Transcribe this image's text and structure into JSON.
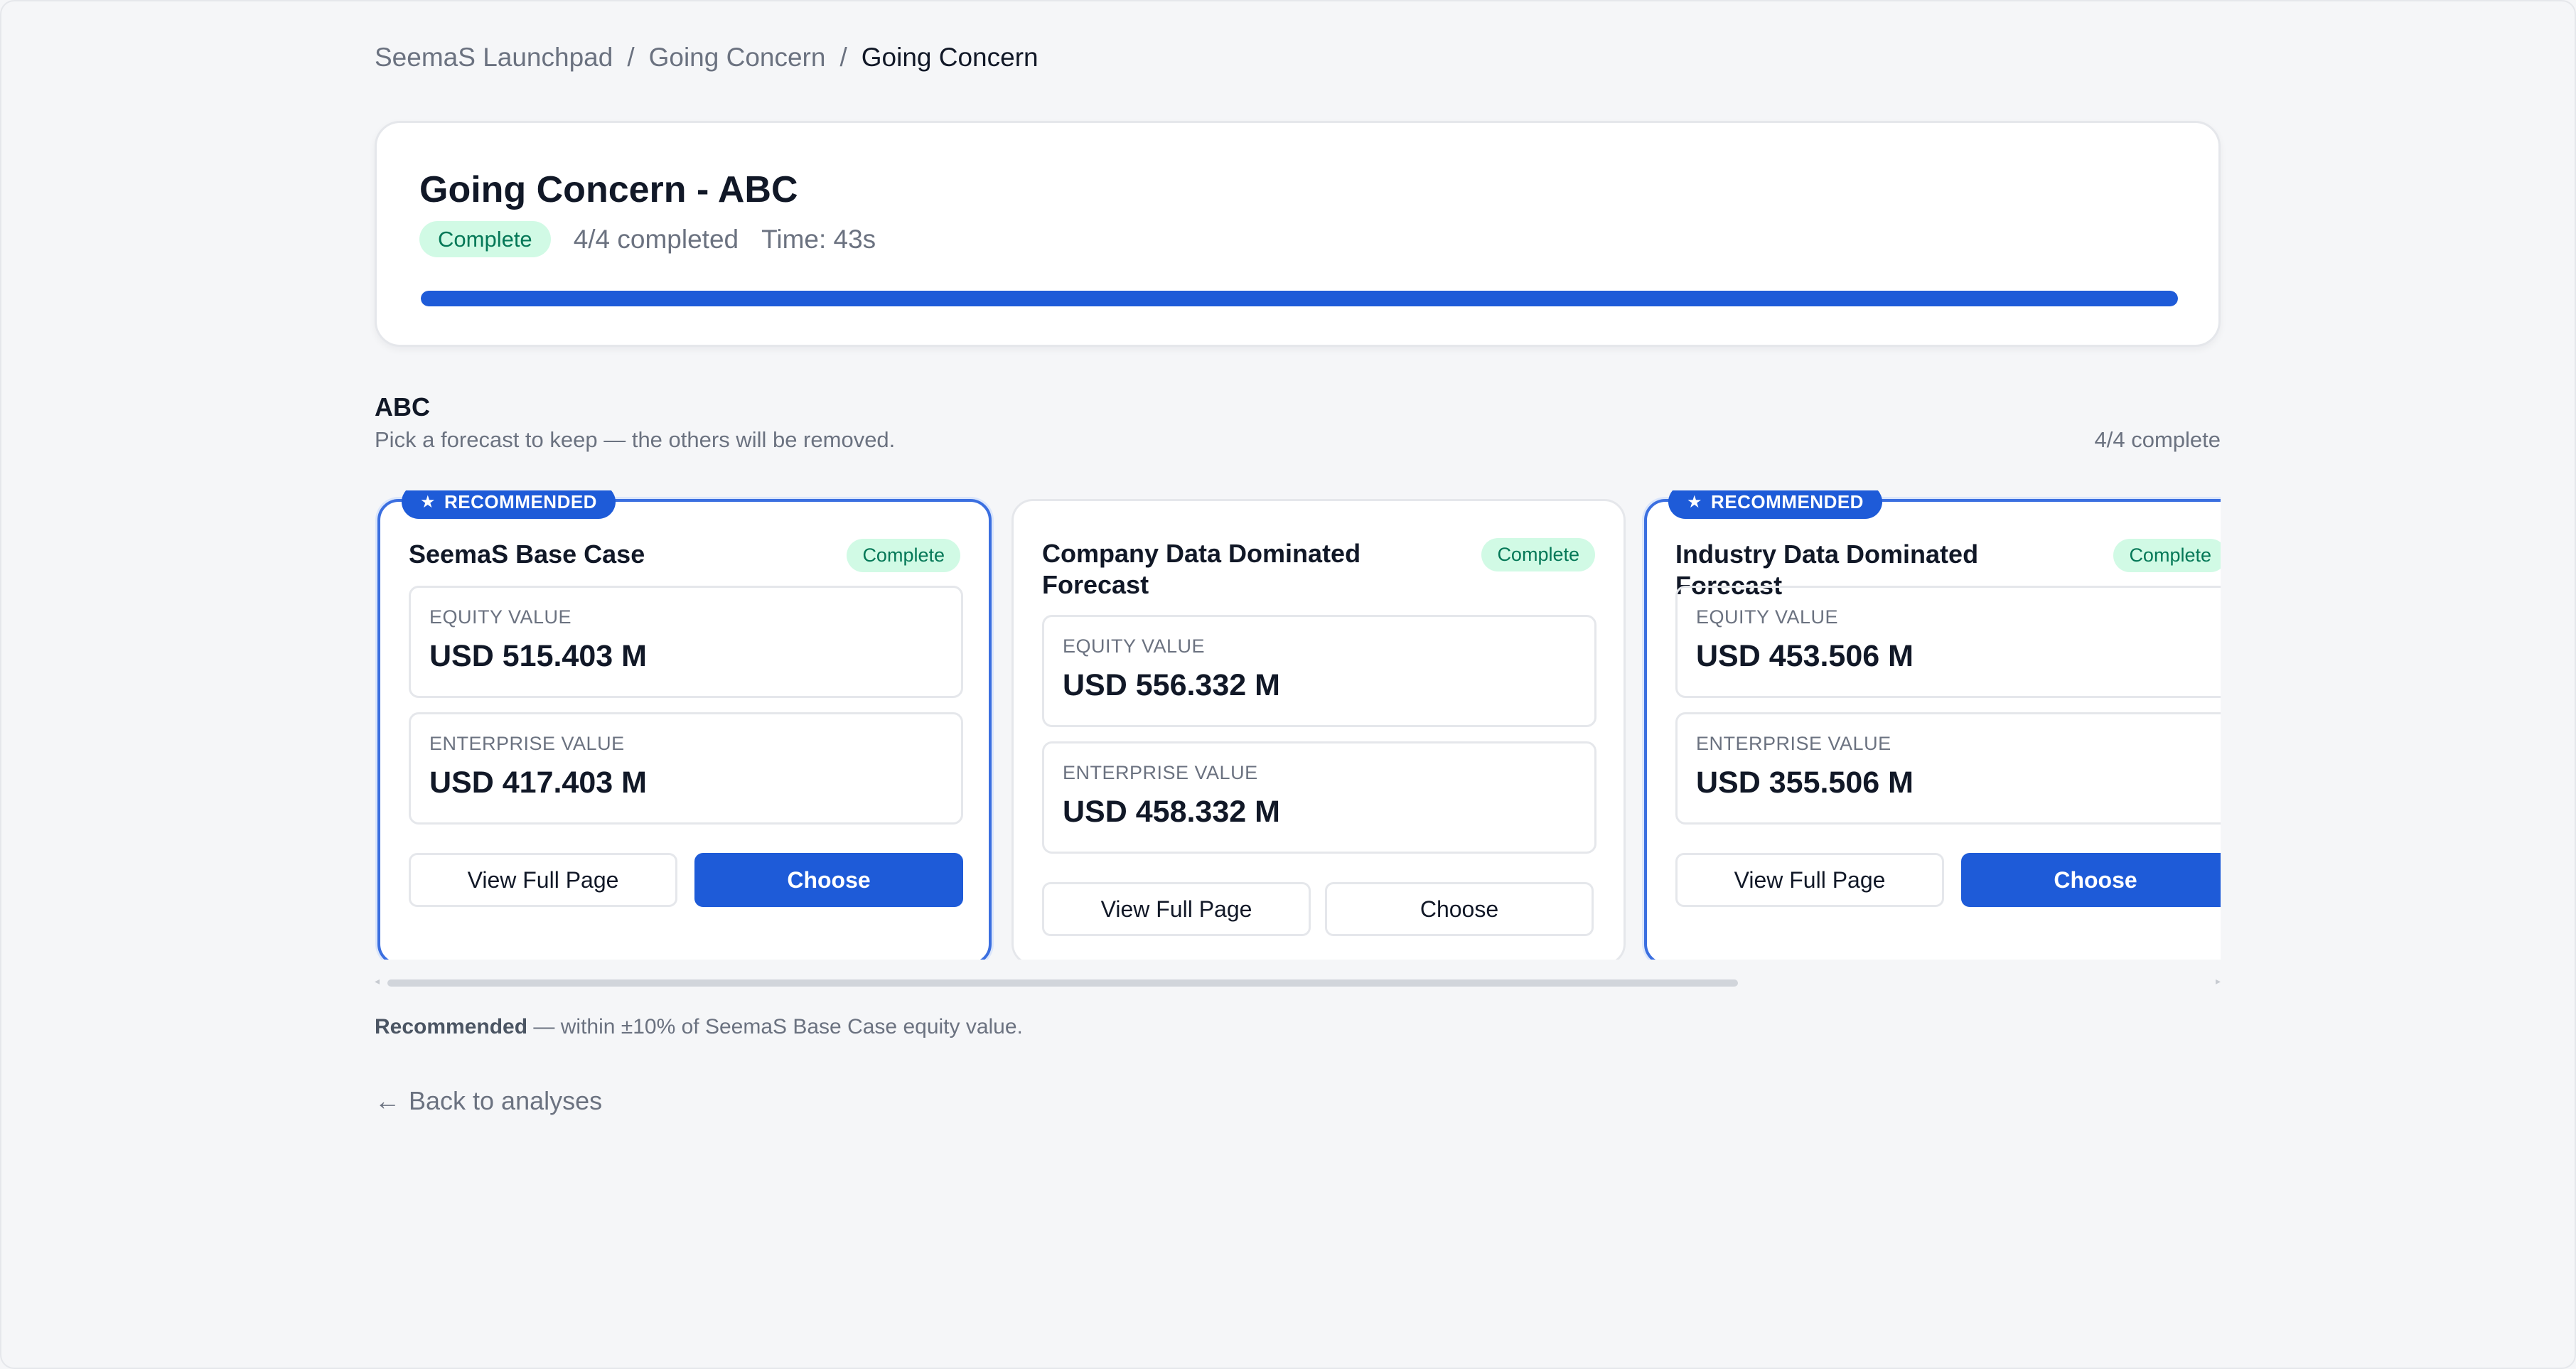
{
  "breadcrumb": {
    "items": [
      "SeemaS Launchpad",
      "Going Concern"
    ],
    "current": "Going Concern",
    "separator": "/"
  },
  "summary": {
    "title": "Going Concern - ABC",
    "status": "Complete",
    "completed": "4/4 completed",
    "time": "Time: 43s",
    "progress_fraction": 1.0
  },
  "section": {
    "title": "ABC",
    "subtitle": "Pick a forecast to keep — the others will be removed.",
    "count": "4/4 complete"
  },
  "cards": [
    {
      "name": "SeemaS Base Case",
      "status": "Complete",
      "recommended": true,
      "recommended_label": "RECOMMENDED",
      "equity_label": "EQUITY VALUE",
      "equity_value": "USD 515.403 M",
      "enterprise_label": "ENTERPRISE VALUE",
      "enterprise_value": "USD 417.403 M",
      "view_label": "View Full Page",
      "choose_label": "Choose"
    },
    {
      "name": "Company Data Dominated Forecast",
      "status": "Complete",
      "recommended": false,
      "equity_label": "EQUITY VALUE",
      "equity_value": "USD 556.332 M",
      "enterprise_label": "ENTERPRISE VALUE",
      "enterprise_value": "USD 458.332 M",
      "view_label": "View Full Page",
      "choose_label": "Choose"
    },
    {
      "name": "Industry Data Dominated Forecast",
      "status": "Complete",
      "recommended": true,
      "recommended_label": "RECOMMENDED",
      "equity_label": "EQUITY VALUE",
      "equity_value": "USD 453.506 M",
      "enterprise_label": "ENTERPRISE VALUE",
      "enterprise_value": "USD 355.506 M",
      "view_label": "View Full Page",
      "choose_label": "Choose"
    }
  ],
  "footnote": {
    "bold": "Recommended",
    "text": " — within ±10% of SeemaS Base Case equity value."
  },
  "back_link": {
    "arrow": "←",
    "label": "Back to analyses"
  },
  "colors": {
    "accent": "#1e5bd8",
    "success_bg": "#d1fae5",
    "success_text": "#047857",
    "background": "#f5f6f8"
  }
}
